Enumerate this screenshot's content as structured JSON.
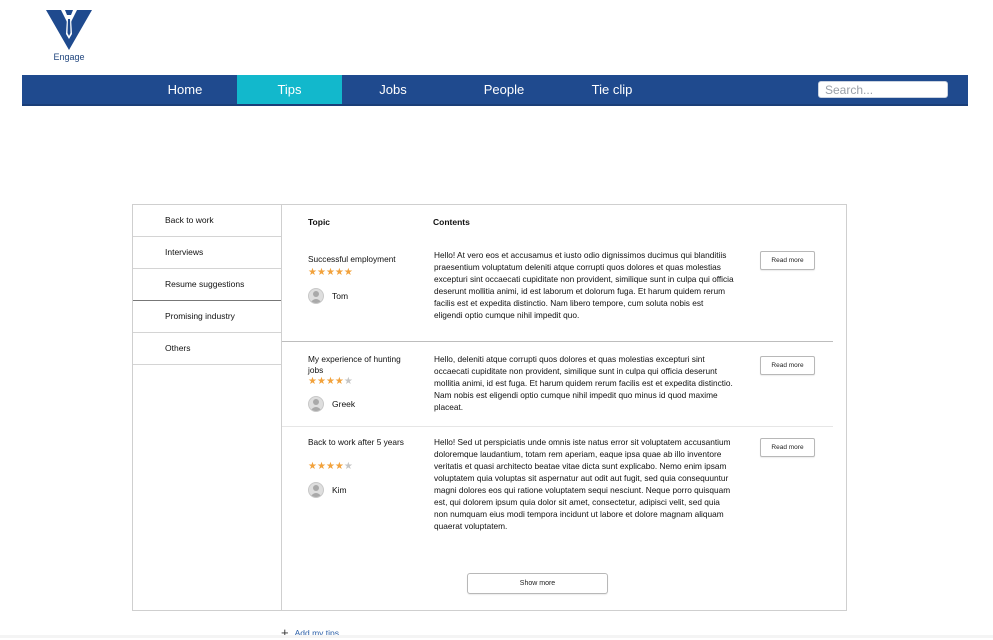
{
  "brand": {
    "name": "Engage",
    "primary_color": "#1f4a8e",
    "accent_color": "#12b8cc"
  },
  "nav": {
    "items": [
      {
        "label": "Home",
        "active": false
      },
      {
        "label": "Tips",
        "active": true
      },
      {
        "label": "Jobs",
        "active": false
      },
      {
        "label": "People",
        "active": false
      },
      {
        "label": "Tie clip",
        "active": false
      }
    ],
    "search_placeholder": "Search..."
  },
  "sidebar": {
    "items": [
      {
        "label": "Back to work"
      },
      {
        "label": "Interviews"
      },
      {
        "label": "Resume suggestions"
      },
      {
        "label": "Promising industry"
      },
      {
        "label": "Others"
      }
    ]
  },
  "table": {
    "topic_header": "Topic",
    "contents_header": "Contents",
    "rows": [
      {
        "title": "Successful employment",
        "rating": 5,
        "author": "Tom",
        "body": "Hello! At vero eos et accusamus et iusto odio dignissimos ducimus qui blanditiis praesentium voluptatum deleniti atque corrupti quos dolores et quas molestias excepturi sint occaecati cupiditate non provident, similique sunt in culpa qui officia deserunt mollitia animi, id est laborum et dolorum fuga. Et harum quidem rerum facilis est et expedita distinctio. Nam libero tempore, cum soluta nobis est eligendi optio cumque nihil impedit quo.",
        "button": "Read more"
      },
      {
        "title": "My experience of hunting jobs",
        "rating": 4,
        "author": "Greek",
        "body": "Hello, deleniti atque corrupti quos dolores et quas molestias excepturi sint occaecati cupiditate non provident, similique sunt in culpa qui officia deserunt mollitia animi, id est fuga. Et harum quidem rerum facilis est et expedita distinctio. Nam nobis est eligendi optio cumque nihil impedit quo minus id quod maxime placeat.",
        "button": "Read more"
      },
      {
        "title": "Back to work after 5 years",
        "rating": 4,
        "author": "Kim",
        "body": "Hello! Sed ut perspiciatis unde omnis iste natus error sit voluptatem accusantium doloremque laudantium, totam rem aperiam, eaque ipsa quae ab illo inventore veritatis et quasi architecto beatae vitae dicta sunt explicabo. Nemo enim ipsam voluptatem quia voluptas sit aspernatur aut odit aut fugit, sed quia consequuntur magni dolores eos qui ratione voluptatem sequi nesciunt. Neque porro quisquam est, qui dolorem ipsum quia dolor sit amet, consectetur, adipisci velit, sed quia non numquam eius modi tempora incidunt ut labore et dolore magnam aliquam quaerat voluptatem.",
        "button": "Read more"
      }
    ],
    "show_more": "Show more"
  },
  "add_tips": {
    "label": "Add my tips",
    "icon": "plus-icon"
  },
  "star_color": "#f2a23c"
}
